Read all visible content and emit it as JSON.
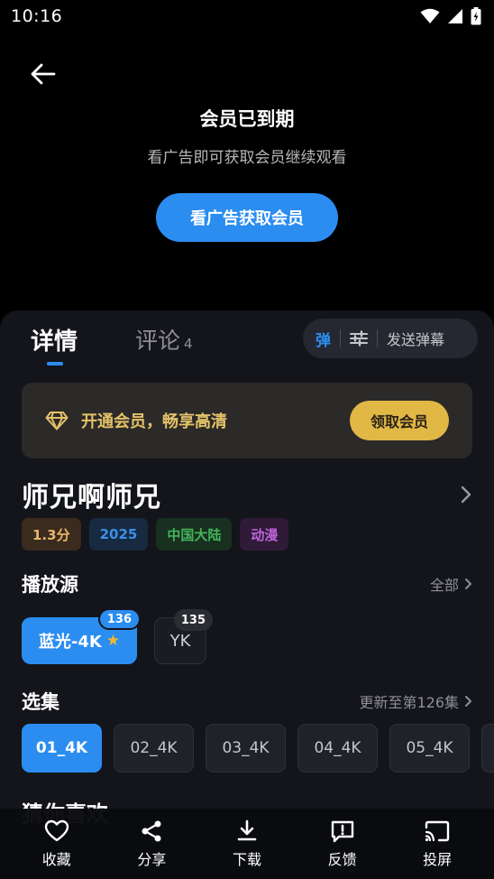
{
  "status_bar": {
    "time": "10:16"
  },
  "player": {
    "expired_title": "会员已到期",
    "expired_subtitle": "看广告即可获取会员继续观看",
    "ad_button": "看广告获取会员"
  },
  "tabs": {
    "detail": "详情",
    "comments": "评论",
    "comments_count": "4"
  },
  "danmaku": {
    "toggle_label": "弹",
    "send_label": "发送弹幕"
  },
  "vip_banner": {
    "text": "开通会员，畅享高清",
    "button": "领取会员"
  },
  "show": {
    "title": "师兄啊师兄",
    "tags": [
      {
        "label": "1.3分",
        "color": "#e7b66a"
      },
      {
        "label": "2025",
        "color": "#3b8fe8"
      },
      {
        "label": "中国大陆",
        "color": "#44b35a"
      },
      {
        "label": "动漫",
        "color": "#c065dd"
      }
    ]
  },
  "sources": {
    "title": "播放源",
    "more": "全部",
    "items": [
      {
        "label": "蓝光-4K",
        "badge": "136",
        "active": true
      },
      {
        "label": "YK",
        "badge": "135",
        "active": false
      }
    ]
  },
  "episodes": {
    "title": "选集",
    "update_info": "更新至第126集",
    "items": [
      "01_4K",
      "02_4K",
      "03_4K",
      "04_4K",
      "05_4K"
    ]
  },
  "guess": {
    "title": "猜你喜欢"
  },
  "bottom_bar": {
    "favorite": "收藏",
    "share": "分享",
    "download": "下载",
    "feedback": "反馈",
    "cast": "投屏"
  },
  "colors": {
    "accent": "#2c8df0",
    "gold": "#e1b846",
    "panel_bg": "#13151b"
  }
}
